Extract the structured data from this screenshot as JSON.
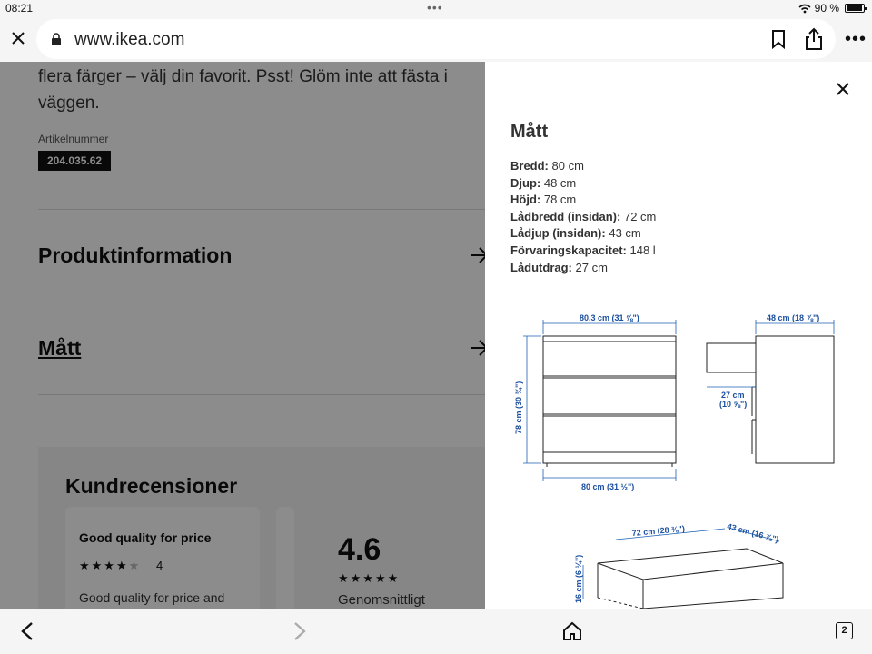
{
  "status": {
    "time": "08:21",
    "battery": "90 %"
  },
  "browser": {
    "url": "www.ikea.com"
  },
  "page": {
    "description": "flera färger – välj din favorit. Psst! Glöm inte att fästa i väggen.",
    "article_label": "Artikelnummer",
    "article_number": "204.035.62",
    "sections": [
      {
        "label": "Produktinformation"
      },
      {
        "label": "Mått"
      }
    ],
    "reviews": {
      "title": "Kundrecensioner",
      "card": {
        "title": "Good quality for price",
        "rating": "4",
        "text": "Good quality for price and"
      },
      "average": "4.6",
      "average_label": "Genomsnittligt"
    }
  },
  "panel": {
    "title": "Mått",
    "specs": [
      {
        "label": "Bredd:",
        "value": "80 cm"
      },
      {
        "label": "Djup:",
        "value": "48 cm"
      },
      {
        "label": "Höjd:",
        "value": "78 cm"
      },
      {
        "label": "Lådbredd (insidan):",
        "value": "72 cm"
      },
      {
        "label": "Lådjup (insidan):",
        "value": "43 cm"
      },
      {
        "label": "Förvaringskapacitet:",
        "value": "148 l"
      },
      {
        "label": "Lådutdrag:",
        "value": "27 cm"
      }
    ],
    "diagram": {
      "top_width": "80.3 cm (31 ⅝\")",
      "height": "78 cm (30 ¾\")",
      "bottom_width": "80 cm (31 ½\")",
      "depth": "48 cm (18 ⅞\")",
      "drawer_pull_1": "27 cm",
      "drawer_pull_2": "(10 ⅝\")",
      "drawer_width": "72 cm (28 ⅜\")",
      "drawer_depth": "43 cm (16 ⅞\")",
      "drawer_height": "16 cm (6 ¼\")"
    }
  },
  "bottom": {
    "tab_count": "2"
  },
  "colors": {
    "dim": "#000000",
    "accent": "#1b5fb3",
    "diagram_label": "#1b4fa0"
  }
}
